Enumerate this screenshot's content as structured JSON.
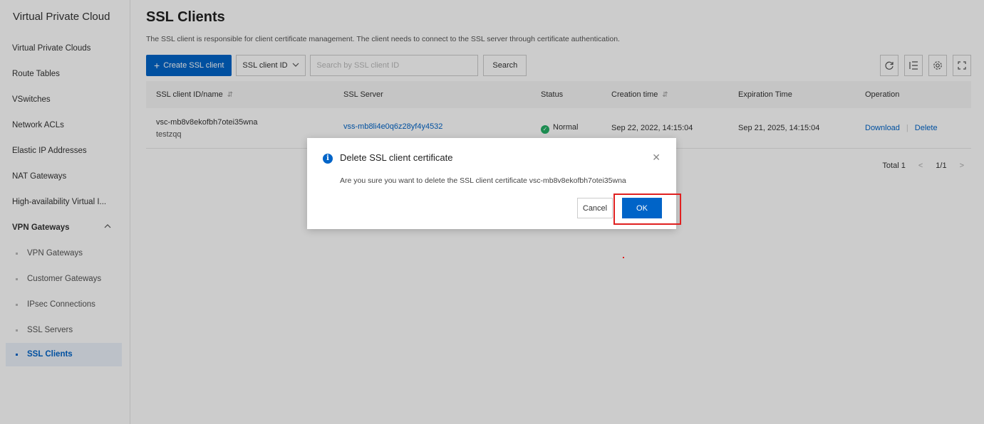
{
  "sidebar": {
    "title": "Virtual Private Cloud",
    "items": [
      {
        "label": "Virtual Private Clouds"
      },
      {
        "label": "Route Tables"
      },
      {
        "label": "VSwitches"
      },
      {
        "label": "Network ACLs"
      },
      {
        "label": "Elastic IP Addresses"
      },
      {
        "label": "NAT Gateways"
      },
      {
        "label": "High-availability Virtual I..."
      }
    ],
    "group": {
      "label": "VPN Gateways",
      "icon": "chevron-up-icon"
    },
    "sub_items": [
      {
        "label": "VPN Gateways"
      },
      {
        "label": "Customer Gateways"
      },
      {
        "label": "IPsec Connections"
      },
      {
        "label": "SSL Servers"
      },
      {
        "label": "SSL Clients",
        "active": true
      }
    ]
  },
  "page": {
    "title": "SSL Clients",
    "description": "The SSL client is responsible for client certificate management. The client needs to connect to the SSL server through certificate authentication."
  },
  "toolbar": {
    "create_label": "Create SSL client",
    "select_value": "SSL client ID",
    "search_placeholder": "Search by SSL client ID",
    "search_label": "Search",
    "icons": [
      "refresh-icon",
      "column-settings-icon",
      "gear-icon",
      "fullscreen-icon"
    ]
  },
  "table": {
    "headers": [
      "SSL client ID/name",
      "SSL Server",
      "Status",
      "Creation time",
      "Expiration Time",
      "Operation"
    ],
    "rows": [
      {
        "id": "vsc-mb8v8ekofbh7otei35wna",
        "name": "testzqq",
        "server": "vss-mb8li4e0q6z28yf4y4532",
        "server_line2": "",
        "status": "Normal",
        "creation_time": "Sep 22, 2022, 14:15:04",
        "expiration_time": "Sep 21, 2025, 14:15:04",
        "op_download": "Download",
        "op_delete": "Delete"
      }
    ]
  },
  "pagination": {
    "total": "Total 1",
    "page": "1/1"
  },
  "dialog": {
    "title": "Delete SSL client certificate",
    "message": "Are you sure you want to delete the SSL client certificate vsc-mb8v8ekofbh7otei35wna",
    "cancel_label": "Cancel",
    "ok_label": "OK"
  },
  "colors": {
    "primary": "#0064c8",
    "status_normal": "#23b066",
    "highlight": "#e02020"
  }
}
